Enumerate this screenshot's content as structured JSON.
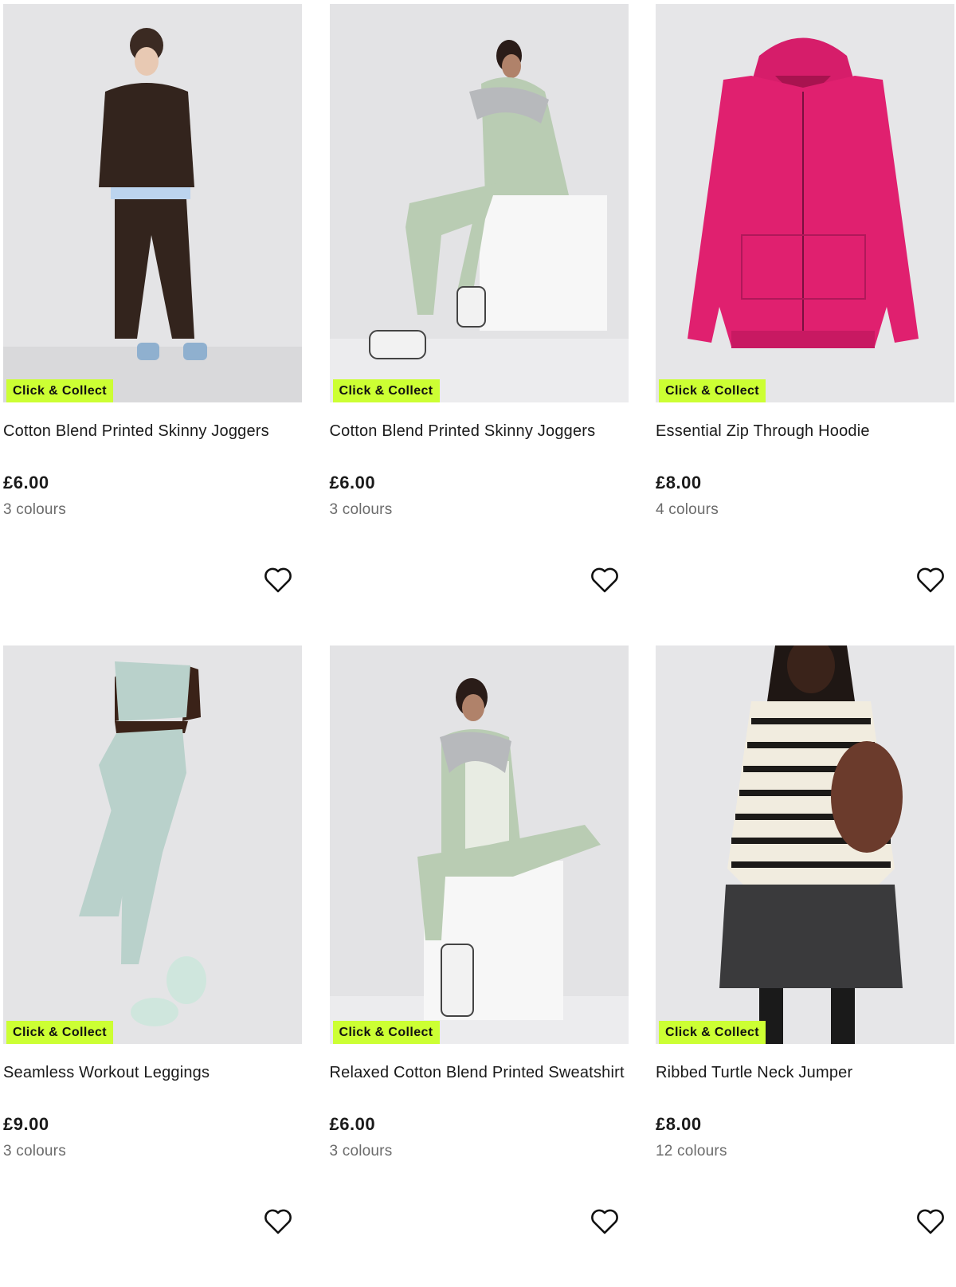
{
  "colors": {
    "badge_bg": "#ccff33",
    "text": "#1a1a1a",
    "muted": "#6b6b6b"
  },
  "products": [
    {
      "badge": "Click & Collect",
      "title": "Cotton Blend Printed Skinny Joggers",
      "price": "£6.00",
      "colours": "3 colours",
      "image": "model-brown-sweatshirt-joggers",
      "wishlist_icon": "heart-outline-icon"
    },
    {
      "badge": "Click & Collect",
      "title": "Cotton Blend Printed Skinny Joggers",
      "price": "£6.00",
      "colours": "3 colours",
      "image": "model-sage-tracksuit-seated",
      "wishlist_icon": "heart-outline-icon"
    },
    {
      "badge": "Click & Collect",
      "title": "Essential Zip Through Hoodie",
      "price": "£8.00",
      "colours": "4 colours",
      "image": "pink-zip-hoodie",
      "wishlist_icon": "heart-outline-icon"
    },
    {
      "badge": "Click & Collect",
      "title": "Seamless Workout Leggings",
      "price": "£9.00",
      "colours": "3 colours",
      "image": "model-mint-leggings",
      "wishlist_icon": "heart-outline-icon"
    },
    {
      "badge": "Click & Collect",
      "title": "Relaxed Cotton Blend Printed Sweatshirt",
      "price": "£6.00",
      "colours": "3 colours",
      "image": "model-sage-sweatshirt-seated",
      "wishlist_icon": "heart-outline-icon"
    },
    {
      "badge": "Click & Collect",
      "title": "Ribbed Turtle Neck Jumper",
      "price": "£8.00",
      "colours": "12 colours",
      "image": "model-striped-turtleneck",
      "wishlist_icon": "heart-outline-icon"
    }
  ]
}
